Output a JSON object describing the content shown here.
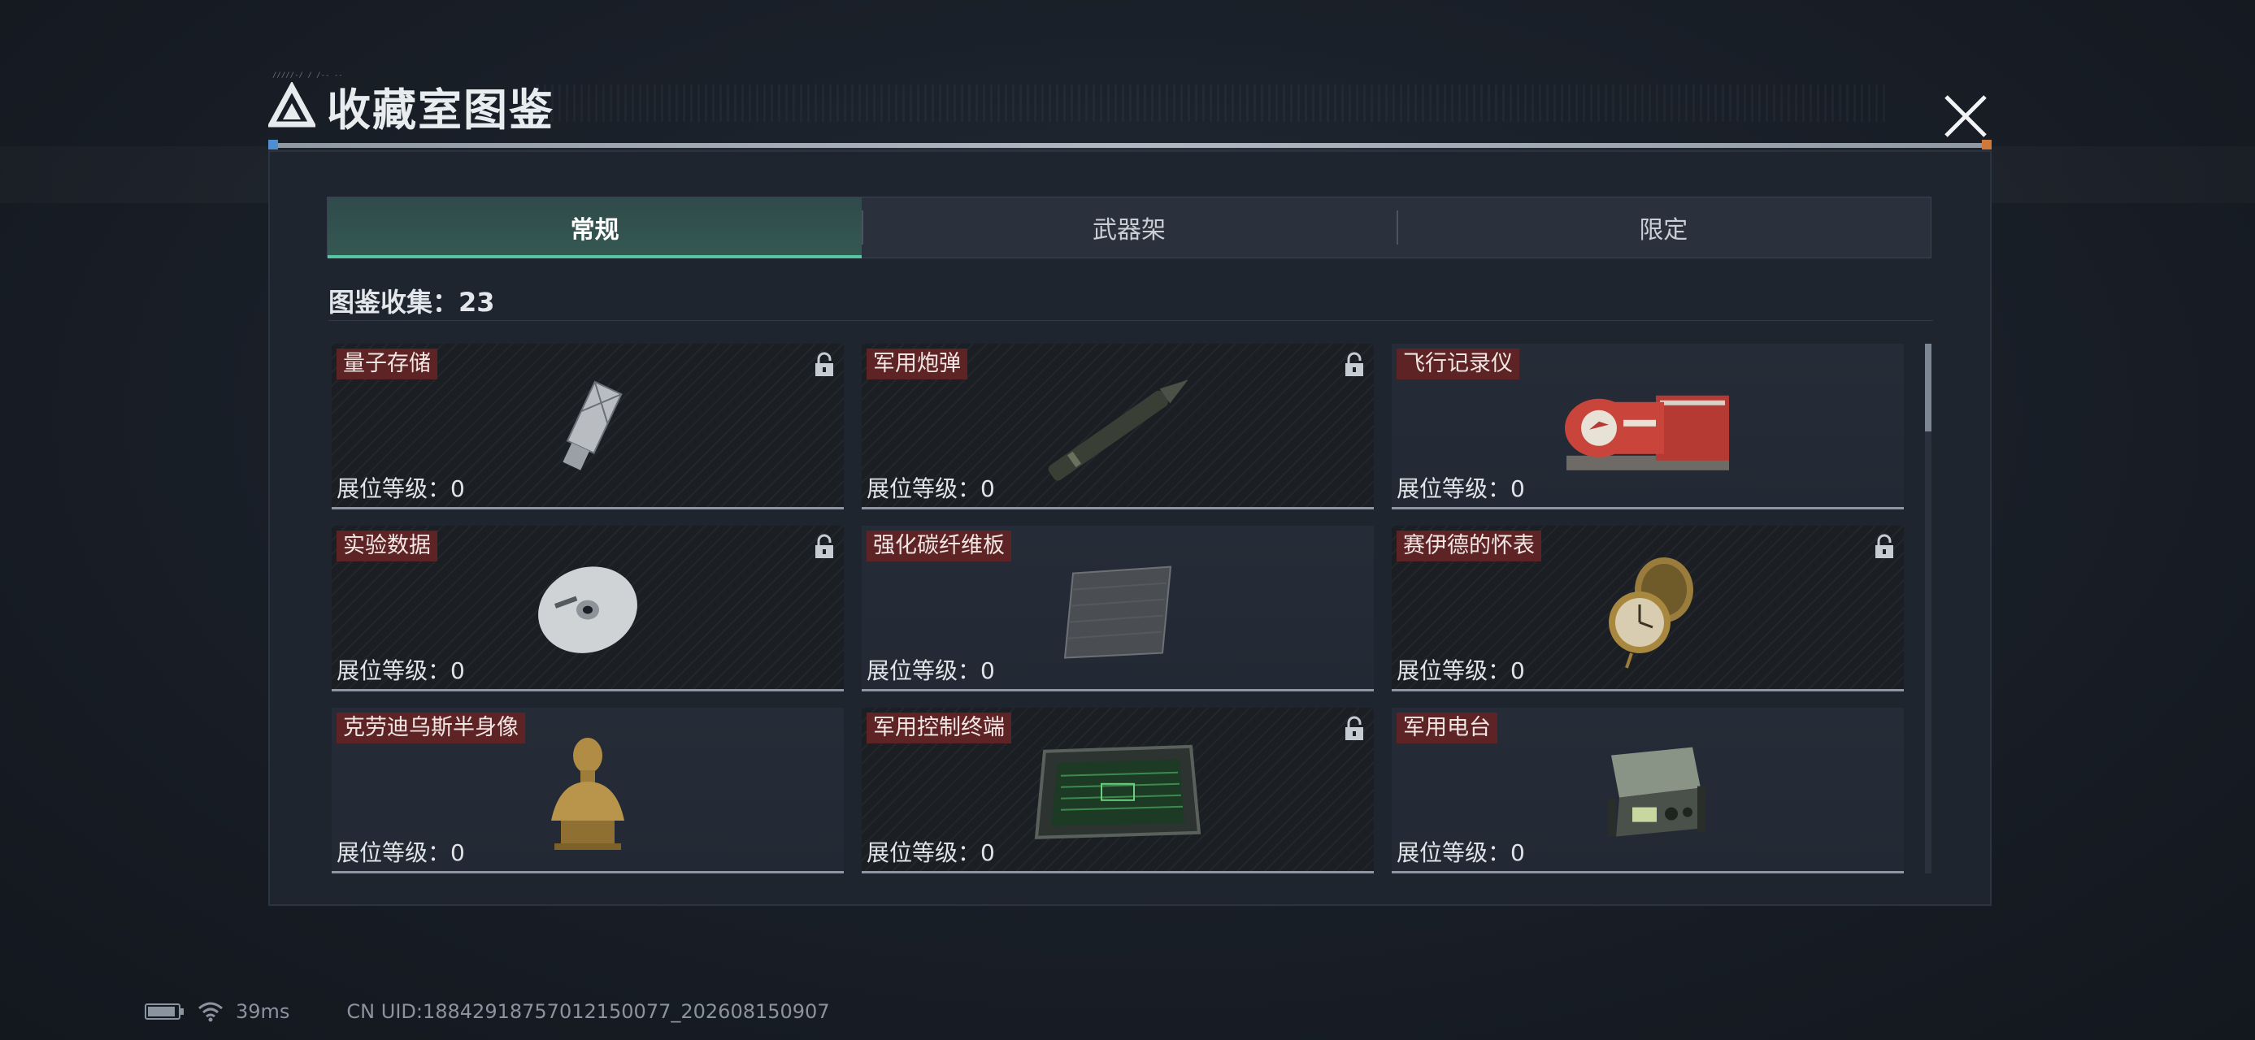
{
  "header": {
    "title": "收藏室图鉴",
    "tiny_mark": "/////-/ /  /-- --"
  },
  "tabs": [
    {
      "label": "常规",
      "active": true
    },
    {
      "label": "武器架",
      "active": false
    },
    {
      "label": "限定",
      "active": false
    }
  ],
  "collection": {
    "text": "图鉴收集：23"
  },
  "items": [
    {
      "name": "量子存储",
      "level_label": "展位等级：",
      "level": "0",
      "locked": true,
      "icon": "usb-drive-icon"
    },
    {
      "name": "军用炮弹",
      "level_label": "展位等级：",
      "level": "0",
      "locked": true,
      "icon": "artillery-shell-icon"
    },
    {
      "name": "飞行记录仪",
      "level_label": "展位等级：",
      "level": "0",
      "locked": false,
      "icon": "flight-recorder-icon"
    },
    {
      "name": "实验数据",
      "level_label": "展位等级：",
      "level": "0",
      "locked": true,
      "icon": "disc-icon"
    },
    {
      "name": "强化碳纤维板",
      "level_label": "展位等级：",
      "level": "0",
      "locked": false,
      "icon": "carbon-plate-icon"
    },
    {
      "name": "赛伊德的怀表",
      "level_label": "展位等级：",
      "level": "0",
      "locked": true,
      "icon": "pocket-watch-icon"
    },
    {
      "name": "克劳迪乌斯半身像",
      "level_label": "展位等级：",
      "level": "0",
      "locked": false,
      "icon": "bust-icon"
    },
    {
      "name": "军用控制终端",
      "level_label": "展位等级：",
      "level": "0",
      "locked": true,
      "icon": "control-terminal-icon"
    },
    {
      "name": "军用电台",
      "level_label": "展位等级：",
      "level": "0",
      "locked": false,
      "icon": "military-radio-icon"
    }
  ],
  "status_bar": {
    "ping": "39ms",
    "uid": "CN UID:18842918757012150077_202608150907"
  },
  "colors": {
    "accent_tab": "#55c8a3",
    "name_tag_bg": "#5e2324",
    "panel_bg": "#1f252f"
  }
}
